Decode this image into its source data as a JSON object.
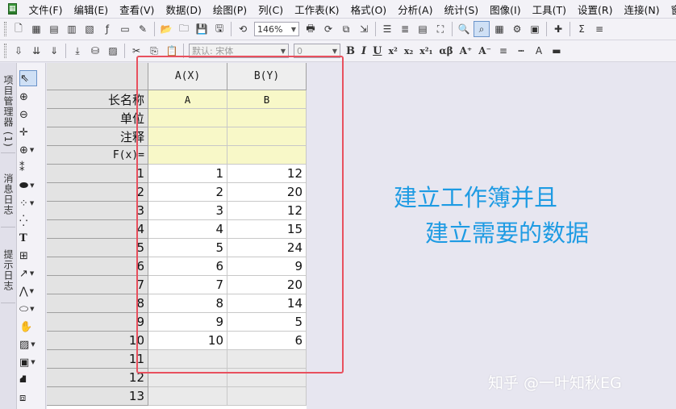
{
  "menu": [
    "文件(F)",
    "编辑(E)",
    "查看(V)",
    "数据(D)",
    "绘图(P)",
    "列(C)",
    "工作表(K)",
    "格式(O)",
    "分析(A)",
    "统计(S)",
    "图像(I)",
    "工具(T)",
    "设置(R)",
    "连接(N)",
    "窗口(W)"
  ],
  "toolbar": {
    "zoom": "146%",
    "font": "默认: 宋体",
    "font_size": "0"
  },
  "sidetabs": [
    "项目管理器 (1)",
    "消息日志",
    "提示日志"
  ],
  "sheet": {
    "columns": [
      {
        "header": "A(X)",
        "long_name": "A",
        "unit": "",
        "comment": "",
        "fx": ""
      },
      {
        "header": "B(Y)",
        "long_name": "B",
        "unit": "",
        "comment": "",
        "fx": ""
      }
    ],
    "meta_labels": [
      "长名称",
      "单位",
      "注释",
      "F(x)="
    ],
    "rows": [
      {
        "n": "1",
        "a": "1",
        "b": "12"
      },
      {
        "n": "2",
        "a": "2",
        "b": "20"
      },
      {
        "n": "3",
        "a": "3",
        "b": "12"
      },
      {
        "n": "4",
        "a": "4",
        "b": "15"
      },
      {
        "n": "5",
        "a": "5",
        "b": "24"
      },
      {
        "n": "6",
        "a": "6",
        "b": "9"
      },
      {
        "n": "7",
        "a": "7",
        "b": "20"
      },
      {
        "n": "8",
        "a": "8",
        "b": "14"
      },
      {
        "n": "9",
        "a": "9",
        "b": "5"
      },
      {
        "n": "10",
        "a": "10",
        "b": "6"
      },
      {
        "n": "11",
        "a": "",
        "b": ""
      },
      {
        "n": "12",
        "a": "",
        "b": ""
      },
      {
        "n": "13",
        "a": "",
        "b": ""
      }
    ]
  },
  "annotation": {
    "line1": "建立工作簿并且",
    "line2": "建立需要的数据"
  },
  "watermark": "知乎 @一叶知秋EG",
  "colors": {
    "annotation": "#1e9be3",
    "highlight_box": "#e8505e",
    "meta_rows": "#f8f8c8"
  }
}
